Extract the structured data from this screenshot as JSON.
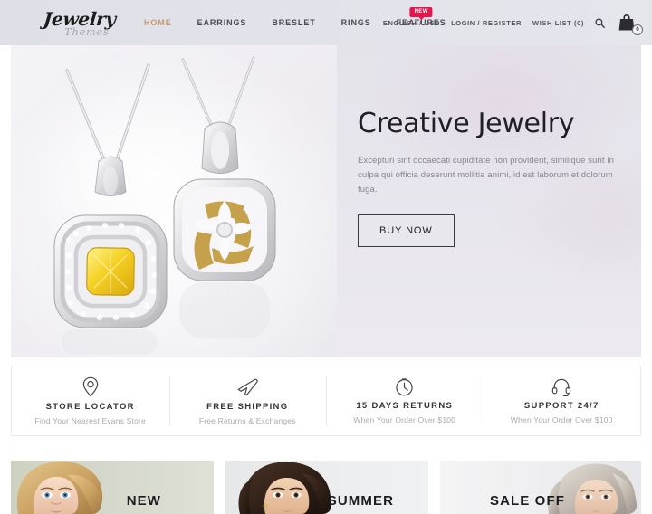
{
  "header": {
    "logo": {
      "main": "Jewelry",
      "sub": "Themes"
    },
    "nav": [
      {
        "label": "HOME",
        "active": true,
        "badge": null
      },
      {
        "label": "EARRINGS",
        "active": false,
        "badge": null
      },
      {
        "label": "BRESLET",
        "active": false,
        "badge": null
      },
      {
        "label": "RINGS",
        "active": false,
        "badge": null
      },
      {
        "label": "FEATURES",
        "active": false,
        "badge": "NEW"
      }
    ],
    "utilities": [
      {
        "label": "ENGLISH  / USD",
        "name": "language-currency-selector"
      },
      {
        "label": "LOGIN / REGISTER",
        "name": "login-register-link"
      },
      {
        "label": "WISH LIST (0)",
        "name": "wishlist-link"
      }
    ],
    "search_icon": "search-icon",
    "cart_icon": "shopping-bag-icon",
    "cart_count": "0",
    "badge_color": "#e3174c",
    "active_nav_color": "#c59a6d"
  },
  "hero": {
    "title": "Creative Jewelry",
    "description": "Excepturi sint occaecati cupiditate non provident, similique sunt in culpa qui officia deserunt mollitia animi, id est laborum et dolorum fuga.",
    "cta_label": "BUY NOW",
    "image_alt": "two-diamond-pendant-necklaces"
  },
  "features": [
    {
      "icon": "map-pin-icon",
      "title": "STORE LOCATOR",
      "subtitle": "Find Your Nearest Evans Store"
    },
    {
      "icon": "airplane-icon",
      "title": "FREE SHIPPING",
      "subtitle": "Free Returns & Exchanges"
    },
    {
      "icon": "clock-icon",
      "title": "15 DAYS RETURNS",
      "subtitle": "When Your Order Over $100"
    },
    {
      "icon": "headset-icon",
      "title": "SUPPORT 24/7",
      "subtitle": "When Your Order Over $100"
    }
  ],
  "promos": [
    {
      "label": "NEW",
      "image_alt": "blonde-woman-braided-hair"
    },
    {
      "label": "SUMMER",
      "image_alt": "brunette-woman-long-hair"
    },
    {
      "label": "SALE OFF",
      "image_alt": "silver-blonde-woman"
    }
  ]
}
